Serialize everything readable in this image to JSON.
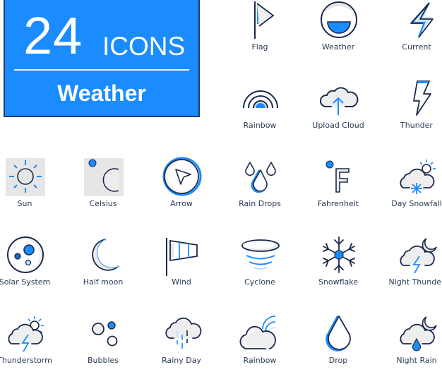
{
  "banner": {
    "count": "24",
    "unit": "ICONS",
    "subtitle": "Weather",
    "background": "#1a8cff",
    "border": "#1f3a6b"
  },
  "colors": {
    "accent": "#1a8cff",
    "stroke": "#1b2a4a",
    "shade": "#e4e4e4",
    "label": "#2b3a55"
  },
  "icons": [
    {
      "label": "Flag",
      "icon": "flag-icon"
    },
    {
      "label": "Weather",
      "icon": "weather-icon"
    },
    {
      "label": "Current",
      "icon": "lightning-bolt-icon"
    },
    {
      "label": "Rainbow",
      "icon": "rainbow-arcs-icon"
    },
    {
      "label": "Upload Cloud",
      "icon": "upload-cloud-icon"
    },
    {
      "label": "Thunder",
      "icon": "thunder-bolt-icon"
    },
    {
      "label": "Sun",
      "icon": "sun-icon"
    },
    {
      "label": "Celsius",
      "icon": "celsius-icon"
    },
    {
      "label": "Arrow",
      "icon": "navigation-arrow-icon"
    },
    {
      "label": "Rain Drops",
      "icon": "rain-drops-icon"
    },
    {
      "label": "Fahrenheit",
      "icon": "fahrenheit-icon"
    },
    {
      "label": "Day Snowfall",
      "icon": "day-snowfall-icon"
    },
    {
      "label": "Solar System",
      "icon": "solar-system-icon"
    },
    {
      "label": "Half moon",
      "icon": "half-moon-icon"
    },
    {
      "label": "Wind",
      "icon": "windsock-icon"
    },
    {
      "label": "Cyclone",
      "icon": "cyclone-icon"
    },
    {
      "label": "Snowflake",
      "icon": "snowflake-icon"
    },
    {
      "label": "Night Thunder",
      "icon": "night-thunder-icon"
    },
    {
      "label": "Thunderstorm",
      "icon": "thunderstorm-icon"
    },
    {
      "label": "Bubbles",
      "icon": "bubbles-icon"
    },
    {
      "label": "Rainy Day",
      "icon": "rainy-day-icon"
    },
    {
      "label": "Rainbow",
      "icon": "cloud-rainbow-icon"
    },
    {
      "label": "Drop",
      "icon": "drop-icon"
    },
    {
      "label": "Night Rain",
      "icon": "night-rain-icon"
    }
  ]
}
